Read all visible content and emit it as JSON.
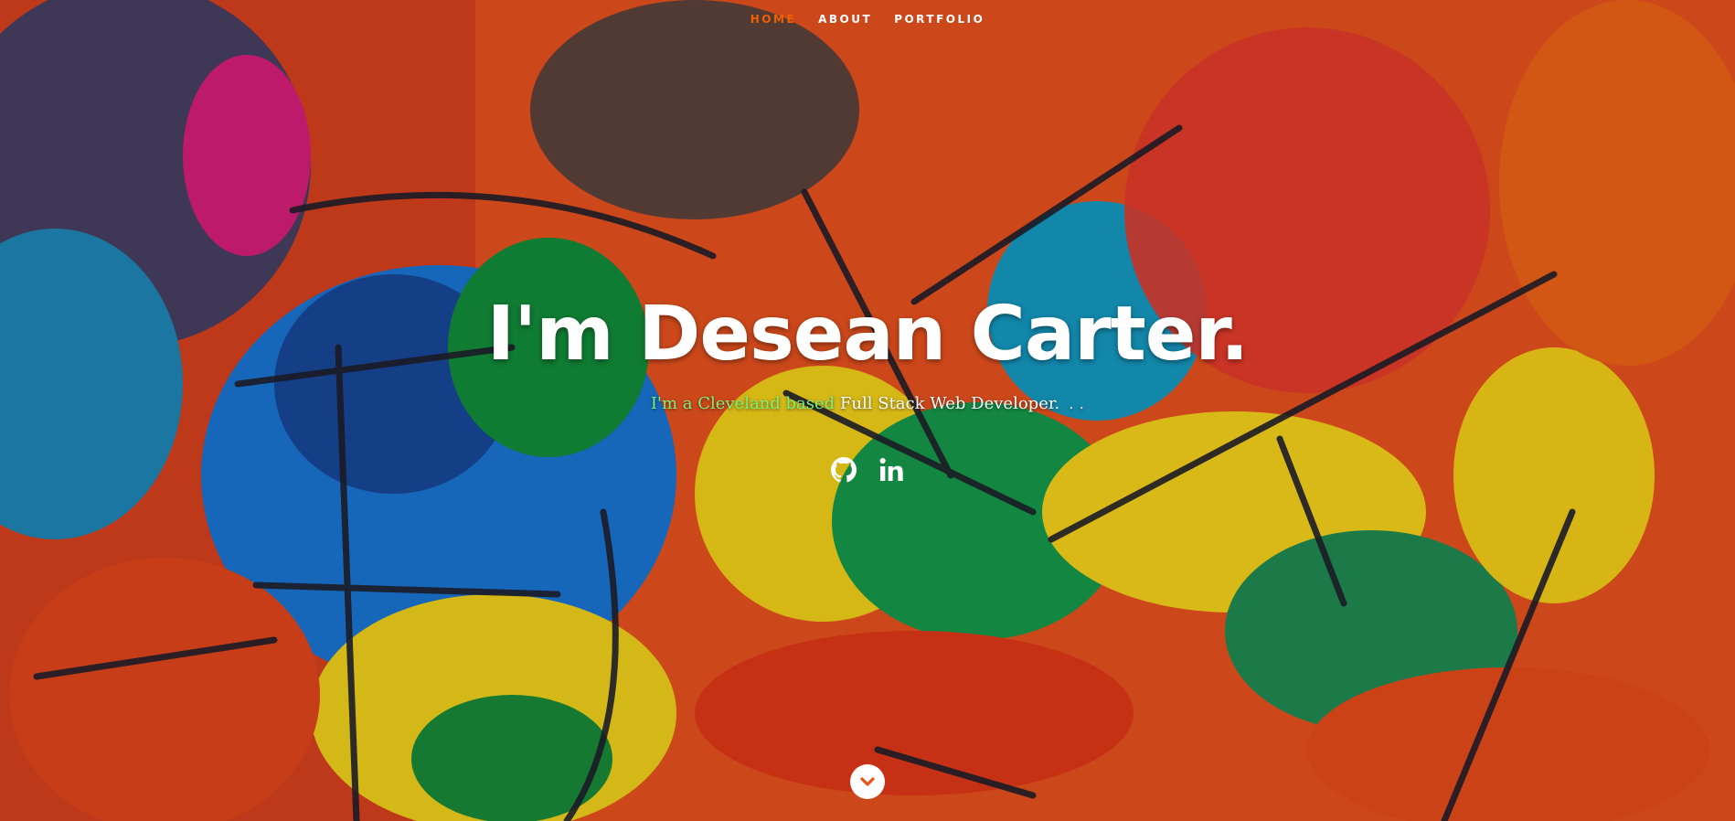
{
  "nav": {
    "items": [
      {
        "label": "Home",
        "active": true
      },
      {
        "label": "About",
        "active": false
      },
      {
        "label": "Portfolio",
        "active": false
      }
    ]
  },
  "hero": {
    "title": "I'm Desean Carter.",
    "tagline_highlight": "I'm a Cleveland based",
    "tagline_rest": "Full Stack Web Developer.",
    "cursor": ". ."
  },
  "social": {
    "icons": [
      "github-icon",
      "linkedin-icon"
    ]
  },
  "colors": {
    "nav_active": "#f06000",
    "tagline_highlight": "#7cf07c",
    "text": "#ffffff"
  },
  "scroll": {
    "icon": "chevron-down-icon"
  }
}
